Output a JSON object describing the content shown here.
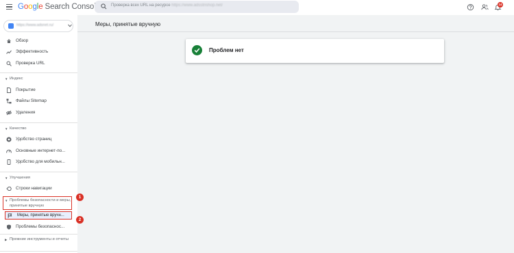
{
  "header": {
    "logo_letters": [
      "G",
      "o",
      "o",
      "g",
      "l",
      "e"
    ],
    "product": "Search Console",
    "search_placeholder": "Проверка всех URL на ресурсе",
    "search_domain": "https://www.adsstrishop.net/",
    "notifications_count": "14",
    "icons": [
      "menu-icon",
      "search-icon",
      "help-icon",
      "users-icon",
      "bell-icon"
    ]
  },
  "sidebar": {
    "property": "https://www.adsnet.ru/",
    "top_items": [
      {
        "label": "Обзор",
        "icon": "home-icon"
      },
      {
        "label": "Эффективность",
        "icon": "trending-icon"
      },
      {
        "label": "Проверка URL",
        "icon": "search-icon"
      }
    ],
    "sections": {
      "index": {
        "title": "Индекс",
        "items": [
          {
            "label": "Покрытие",
            "icon": "file-icon"
          },
          {
            "label": "Файлы Sitemap",
            "icon": "sitemap-icon"
          },
          {
            "label": "Удаления",
            "icon": "eye-off-icon"
          }
        ]
      },
      "quality": {
        "title": "Качество",
        "items": [
          {
            "label": "Удобство страниц",
            "icon": "badge-icon"
          },
          {
            "label": "Основные интернет-по...",
            "icon": "speedometer-icon"
          },
          {
            "label": "Удобство для мобильн...",
            "icon": "mobile-icon"
          }
        ]
      },
      "enhancements": {
        "title": "Улучшения",
        "items": [
          {
            "label": "Строки навигации",
            "icon": "breadcrumb-icon"
          }
        ]
      },
      "security": {
        "title": "Проблемы безопасности и меры, принятые вручную",
        "items": [
          {
            "label": "Меры, принятые вручн...",
            "icon": "flag-icon"
          },
          {
            "label": "Проблемы безопаснос...",
            "icon": "shield-icon"
          }
        ]
      },
      "legacy": {
        "title": "Прежние инструменты и отчеты"
      }
    }
  },
  "annotations": {
    "callout_1": "1",
    "callout_2": "2"
  },
  "main": {
    "title": "Меры, принятые вручную",
    "status": "Проблем нет"
  },
  "colors": {
    "accent_blue": "#4285f4",
    "success_green": "#188038",
    "annotation_red": "#d93025",
    "selected_bg": "#e8f0fe"
  }
}
